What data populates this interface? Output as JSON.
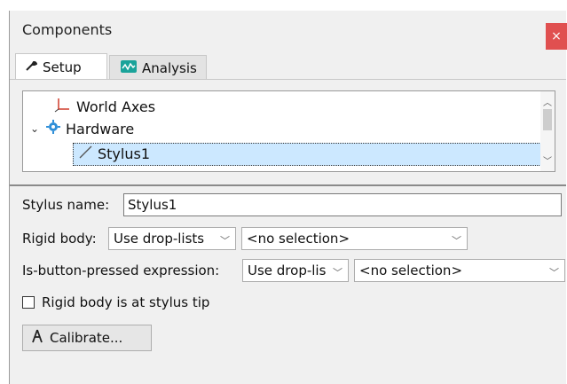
{
  "window": {
    "title": "Components",
    "close_glyph": "×"
  },
  "tabs": [
    {
      "label": "Setup",
      "icon": "wrench-icon",
      "active": true
    },
    {
      "label": "Analysis",
      "icon": "analysis-icon",
      "active": false
    }
  ],
  "tree": {
    "items": [
      {
        "label": "World Axes",
        "icon": "axes-icon"
      },
      {
        "label": "Hardware",
        "icon": "gear-icon",
        "expanded": true
      },
      {
        "label": "Stylus1",
        "icon": "stylus-icon",
        "selected": true
      }
    ]
  },
  "form": {
    "stylus_name_label": "Stylus name:",
    "stylus_name_value": "Stylus1",
    "rigid_body_label": "Rigid body:",
    "rigid_body_mode": "Use drop-lists",
    "rigid_body_selection": "<no selection>",
    "button_expr_label": "Is-button-pressed expression:",
    "button_expr_mode": "Use drop-lis",
    "button_expr_selection": "<no selection>",
    "tip_checkbox_label": "Rigid body is at stylus tip",
    "tip_checked": false,
    "calibrate_label": "Calibrate..."
  },
  "colors": {
    "close_bg": "#e05050",
    "selection_bg": "#cce8ff",
    "analysis_icon": "#1aa39a",
    "gear_icon": "#2f8fd8",
    "axes_red": "#d03a2a"
  }
}
